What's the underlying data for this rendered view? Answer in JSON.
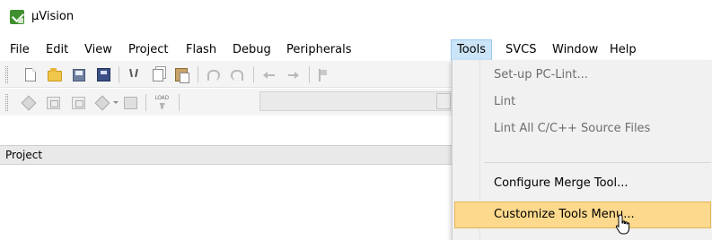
{
  "window": {
    "title": "µVision",
    "icon": "uvision-app-icon"
  },
  "menubar": {
    "items": [
      "File",
      "Edit",
      "View",
      "Project",
      "Flash",
      "Debug",
      "Peripherals",
      "Tools",
      "SVCS",
      "Window",
      "Help"
    ],
    "active": "Tools"
  },
  "toolbar_load_label": "LOAD",
  "project_pane": {
    "title": "Project"
  },
  "tools_menu": {
    "items": [
      {
        "label": "Set-up PC-Lint...",
        "enabled": false
      },
      {
        "label": "Lint",
        "enabled": false
      },
      {
        "label": "Lint All C/C++ Source Files",
        "enabled": false
      },
      {
        "label": "Configure Merge Tool...",
        "enabled": true
      },
      {
        "label": "Customize Tools Menu...",
        "enabled": true,
        "highlighted": true
      }
    ]
  },
  "colors": {
    "menu_active_bg": "#cce4f7",
    "menu_highlight_bg": "#fcd98d",
    "app_icon": "#3f8f2e"
  }
}
